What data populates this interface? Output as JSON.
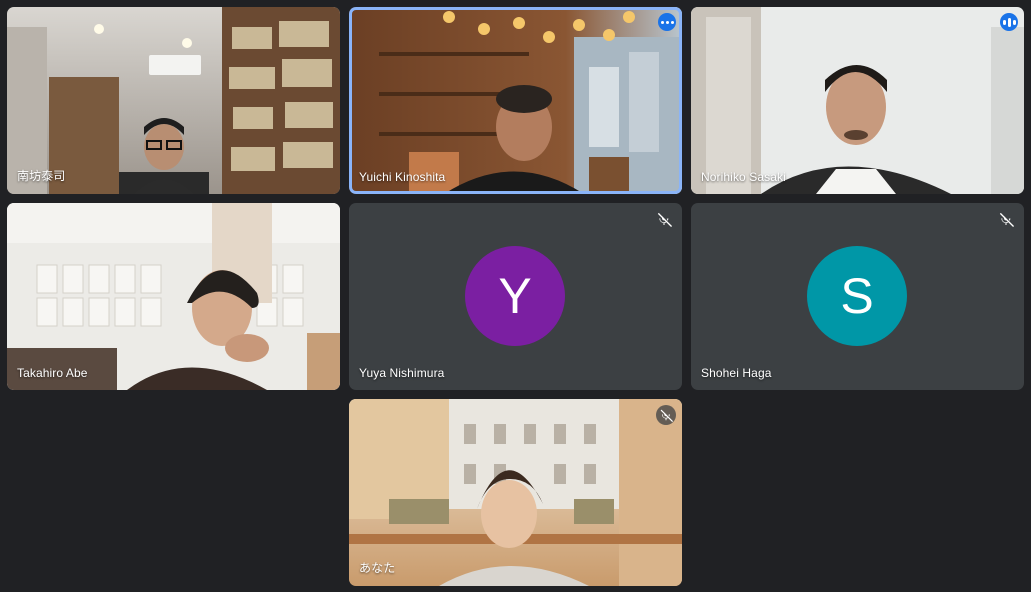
{
  "participants": [
    {
      "name": "南坊泰司"
    },
    {
      "name": "Yuichi Kinoshita"
    },
    {
      "name": "Norihiko Sasaki"
    },
    {
      "name": "Takahiro Abe"
    },
    {
      "name": "Yuya Nishimura",
      "initial": "Y",
      "avatar_color": "#7b1fa2"
    },
    {
      "name": "Shohei Haga",
      "initial": "S",
      "avatar_color": "#0097a7"
    },
    {
      "name": "あなた"
    }
  ],
  "colors": {
    "background": "#202124",
    "tile": "#3c4043",
    "active_border": "#8ab4f8",
    "button_blue": "#1a73e8"
  }
}
